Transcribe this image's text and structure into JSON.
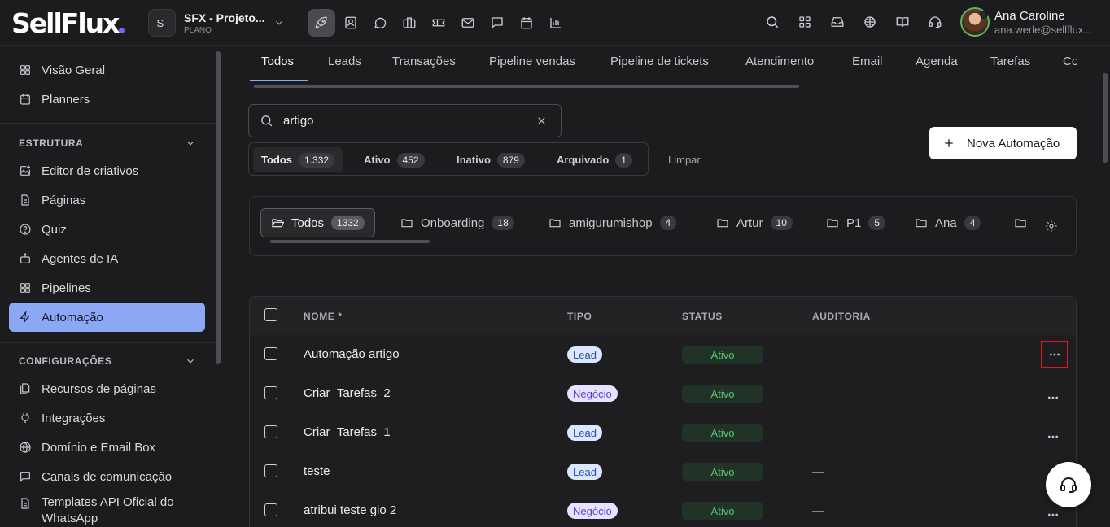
{
  "brand": {
    "logo_text": "SellFlux",
    "accent": "#6f6af8"
  },
  "project": {
    "initials": "S-",
    "name": "SFX - Projeto...",
    "plan": "PLANO"
  },
  "toolbar": {
    "icons": [
      "rocket-icon",
      "contacts-icon",
      "chat-bubble-icon",
      "briefcase-icon",
      "ticket-icon",
      "mail-icon",
      "message-square-icon",
      "calendar-icon",
      "bar-chart-icon"
    ],
    "active": "rocket-icon"
  },
  "header_icons": [
    "search-icon",
    "apps-grid-icon",
    "inbox-icon",
    "globe-brain-icon",
    "book-open-icon",
    "headset-icon"
  ],
  "user": {
    "name": "Ana Caroline",
    "email": "ana.werle@sellflux..."
  },
  "sidebar": {
    "top_items": [
      {
        "label": "Visão Geral",
        "icon": "dashboard-icon"
      },
      {
        "label": "Planners",
        "icon": "calendar-icon"
      }
    ],
    "section1": {
      "title": "ESTRUTURA",
      "items": [
        {
          "label": "Editor de criativos",
          "icon": "image-plus-icon"
        },
        {
          "label": "Páginas",
          "icon": "file-icon"
        },
        {
          "label": "Quiz",
          "icon": "question-circle-icon"
        },
        {
          "label": "Agentes de IA",
          "icon": "bot-icon"
        },
        {
          "label": "Pipelines",
          "icon": "kanban-icon"
        },
        {
          "label": "Automação",
          "icon": "lightning-icon",
          "active": true
        }
      ]
    },
    "section2": {
      "title": "CONFIGURAÇÕES",
      "items": [
        {
          "label": "Recursos de páginas",
          "icon": "file-stack-icon"
        },
        {
          "label": "Integrações",
          "icon": "plug-icon"
        },
        {
          "label": "Domínio e Email Box",
          "icon": "globe-icon"
        },
        {
          "label": "Canais de comunicação",
          "icon": "chat-square-icon"
        },
        {
          "label": "Templates API Oficial do WhatsApp",
          "icon": "file-text-icon"
        }
      ]
    }
  },
  "tabs": [
    "Todos",
    "Leads",
    "Transações",
    "Pipeline vendas",
    "Pipeline de tickets",
    "Atendimento",
    "Email",
    "Agenda",
    "Tarefas",
    "Co"
  ],
  "active_tab": "Todos",
  "search": {
    "value": "artigo"
  },
  "status_filters": [
    {
      "label": "Todos",
      "count": "1.332",
      "active": true
    },
    {
      "label": "Ativo",
      "count": "452"
    },
    {
      "label": "Inativo",
      "count": "879"
    },
    {
      "label": "Arquivado",
      "count": "1"
    }
  ],
  "clear_label": "Limpar",
  "new_button": "Nova Automação",
  "folders": [
    {
      "label": "Todos",
      "count": "1332",
      "active": true
    },
    {
      "label": "Onboarding",
      "count": "18"
    },
    {
      "label": "amigurumishop",
      "count": "4"
    },
    {
      "label": "Artur",
      "count": "10"
    },
    {
      "label": "P1",
      "count": "5"
    },
    {
      "label": "Ana",
      "count": "4"
    },
    {
      "label": "",
      "count": ""
    }
  ],
  "table": {
    "columns": [
      "NOME *",
      "TIPO",
      "STATUS",
      "AUDITORIA"
    ],
    "rows": [
      {
        "name": "Automação artigo",
        "type": "Lead",
        "status": "Ativo",
        "audit": "—"
      },
      {
        "name": "Criar_Tarefas_2",
        "type": "Negócio",
        "status": "Ativo",
        "audit": "—"
      },
      {
        "name": "Criar_Tarefas_1",
        "type": "Lead",
        "status": "Ativo",
        "audit": "—"
      },
      {
        "name": "teste",
        "type": "Lead",
        "status": "Ativo",
        "audit": "—"
      },
      {
        "name": "atribui teste gio 2",
        "type": "Negócio",
        "status": "Ativo",
        "audit": "—"
      }
    ]
  },
  "colors": {
    "sidebar_active": "#8ca8f5",
    "status_active_text": "#57c777",
    "highlight": "#e0191b"
  }
}
